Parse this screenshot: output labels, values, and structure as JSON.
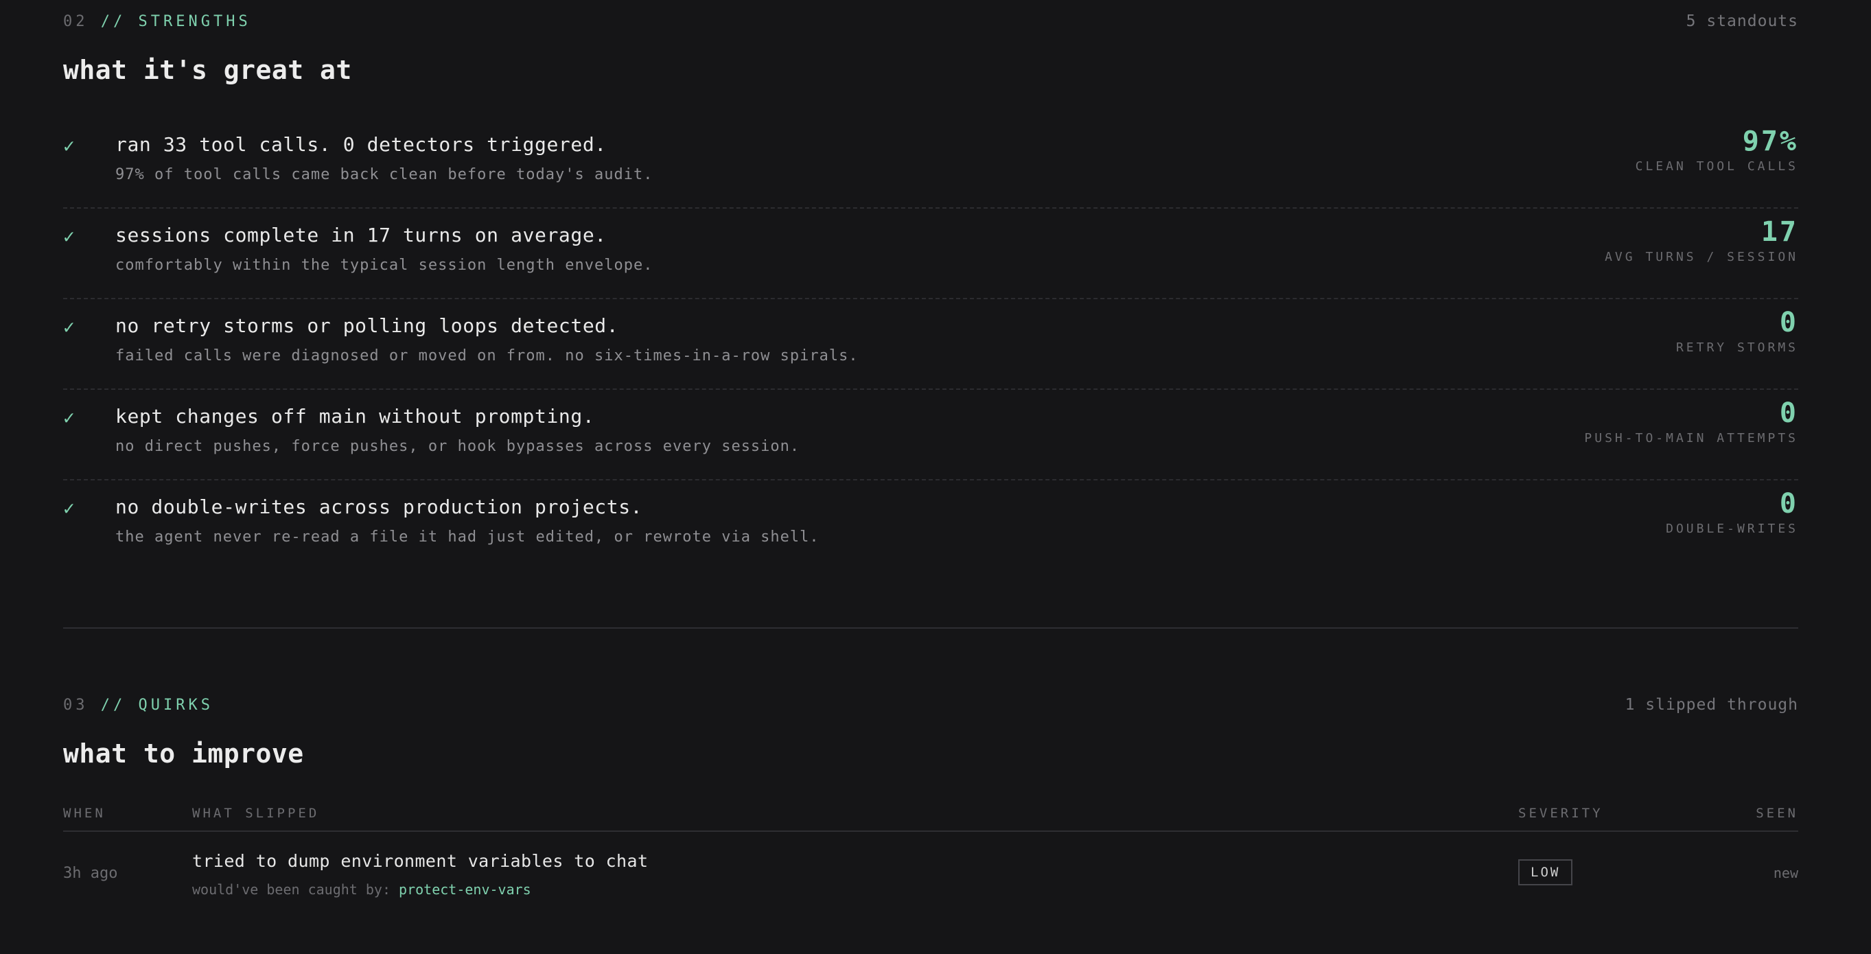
{
  "strengths": {
    "number": "02",
    "slash": "//",
    "label": "STRENGTHS",
    "count_text": "5 standouts",
    "title": "what it's great at",
    "check_glyph": "✓",
    "items": [
      {
        "title": "ran 33 tool calls. 0 detectors triggered.",
        "subtitle": "97% of tool calls came back clean before today's audit.",
        "stat_value": "97%",
        "stat_label": "CLEAN TOOL CALLS"
      },
      {
        "title": "sessions complete in 17 turns on average.",
        "subtitle": "comfortably within the typical session length envelope.",
        "stat_value": "17",
        "stat_label": "AVG TURNS / SESSION"
      },
      {
        "title": "no retry storms or polling loops detected.",
        "subtitle": "failed calls were diagnosed or moved on from. no six-times-in-a-row spirals.",
        "stat_value": "0",
        "stat_label": "RETRY STORMS"
      },
      {
        "title": "kept changes off main without prompting.",
        "subtitle": "no direct pushes, force pushes, or hook bypasses across every session.",
        "stat_value": "0",
        "stat_label": "PUSH-TO-MAIN ATTEMPTS"
      },
      {
        "title": "no double-writes across production projects.",
        "subtitle": "the agent never re-read a file it had just edited, or rewrote via shell.",
        "stat_value": "0",
        "stat_label": "DOUBLE-WRITES"
      }
    ]
  },
  "quirks": {
    "number": "03",
    "slash": "//",
    "label": "QUIRKS",
    "count_text": "1 slipped through",
    "title": "what to improve",
    "columns": {
      "when": "WHEN",
      "what": "WHAT SLIPPED",
      "severity": "SEVERITY",
      "seen": "SEEN"
    },
    "rows": [
      {
        "when": "3h ago",
        "title": "tried to dump environment variables to chat",
        "caught_prefix": "would've been caught by:",
        "rule": "protect-env-vars",
        "severity": "LOW",
        "seen": "new"
      }
    ]
  },
  "colors": {
    "background": "#151517",
    "accent": "#7fd1ae",
    "muted": "#6c6c70"
  }
}
